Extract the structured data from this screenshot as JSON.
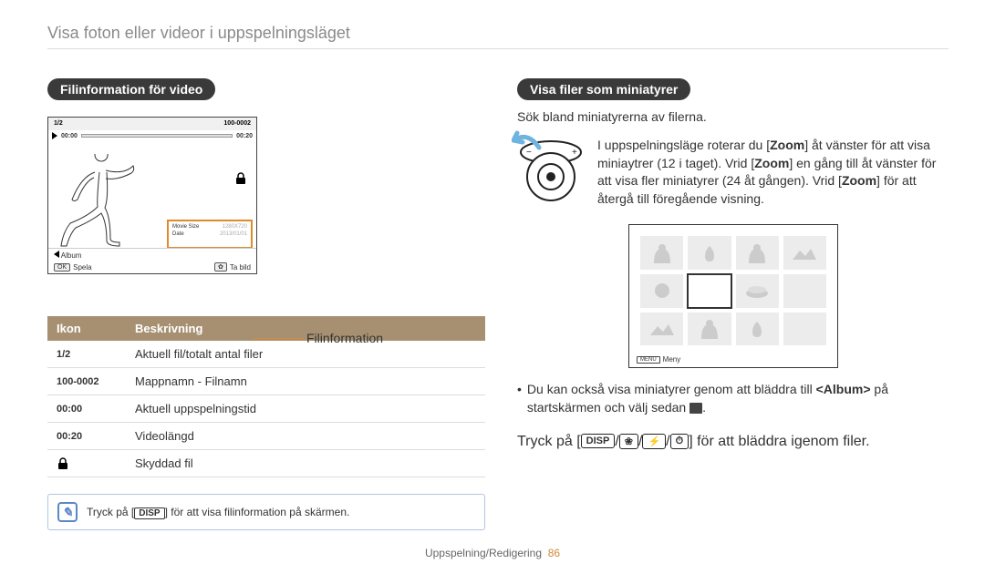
{
  "page_title": "Visa foton eller videor i uppspelningsläget",
  "left": {
    "heading": "Filinformation för video",
    "screen": {
      "counter": "1/2",
      "folder_file": "100-0002",
      "time_current": "00:00",
      "time_total": "00:20",
      "popup_label1": "Movie Size",
      "popup_val1": "1280X720",
      "popup_label2": "Date",
      "popup_val2": "2013/01/01",
      "album": "Album",
      "play": "Spela",
      "capture": "Ta bild"
    },
    "fileinfo_label": "Filinformation",
    "table": {
      "h1": "Ikon",
      "h2": "Beskrivning",
      "rows": [
        {
          "icon": "1/2",
          "desc": "Aktuell fil/totalt antal filer"
        },
        {
          "icon": "100-0002",
          "desc": "Mappnamn - Filnamn"
        },
        {
          "icon": "00:00",
          "desc": "Aktuell uppspelningstid"
        },
        {
          "icon": "00:20",
          "desc": "Videolängd"
        },
        {
          "icon": "lock",
          "desc": "Skyddad fil"
        }
      ]
    },
    "tip_prefix": "Tryck på [",
    "tip_disp": "DISP",
    "tip_suffix": "] för att visa filinformation på skärmen."
  },
  "right": {
    "heading": "Visa filer som miniatyrer",
    "intro": "Sök bland miniatyrerna av filerna.",
    "zoom_p1": "I uppspelningsläge roterar du [",
    "zoom_b1": "Zoom",
    "zoom_p2": "] åt vänster för att visa miniaytrer (12 i taget). Vrid [",
    "zoom_b2": "Zoom",
    "zoom_p3": "] en gång till åt vänster för att visa fler miniatyrer (24 åt gången). Vrid [",
    "zoom_b3": "Zoom",
    "zoom_p4": "] för att återgå till föregående visning.",
    "thumb_menu": "Meny",
    "bullet_p1": "Du kan också visa miniatyrer genom att bläddra till ",
    "bullet_b1": "<Album>",
    "bullet_p2": " på startskärmen och välj sedan ",
    "nav_p1": "Tryck på [",
    "nav_disp": "DISP",
    "nav_p2": "] för att bläddra igenom filer."
  },
  "footer_section": "Uppspelning/Redigering",
  "footer_page": "86"
}
